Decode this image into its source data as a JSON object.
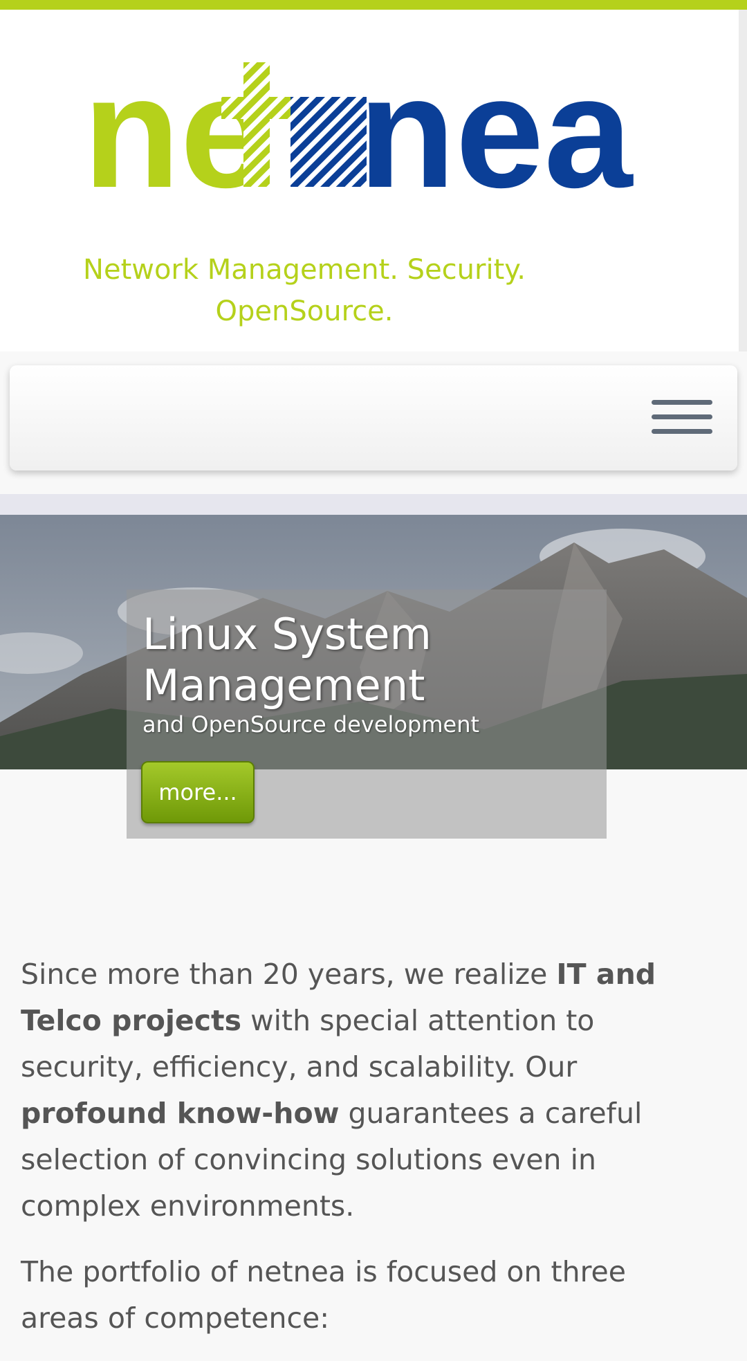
{
  "header": {
    "logo_text": "netnea",
    "tagline_line1": "Network Management. Security.",
    "tagline_line2": "OpenSource."
  },
  "nav": {
    "menu_icon": "hamburger-menu-icon"
  },
  "hero": {
    "title_line1": "Linux System",
    "title_line2": "Management",
    "subtitle": "and OpenSource development",
    "more_label": "more..."
  },
  "content": {
    "p1_a": "Since more than 20 years, we realize ",
    "p1_b": "IT and Telco projects",
    "p1_c": " with special attention to security, efficiency, and scalability. Our ",
    "p1_d": "profound know-how",
    "p1_e": " guarantees a careful selection of convincing solutions even in complex environments.",
    "p2": "The portfolio of netnea is focused on three areas of competence:"
  },
  "colors": {
    "brand_green": "#b5d11b",
    "brand_blue": "#0b3f97",
    "button_green": "#7ea512"
  }
}
